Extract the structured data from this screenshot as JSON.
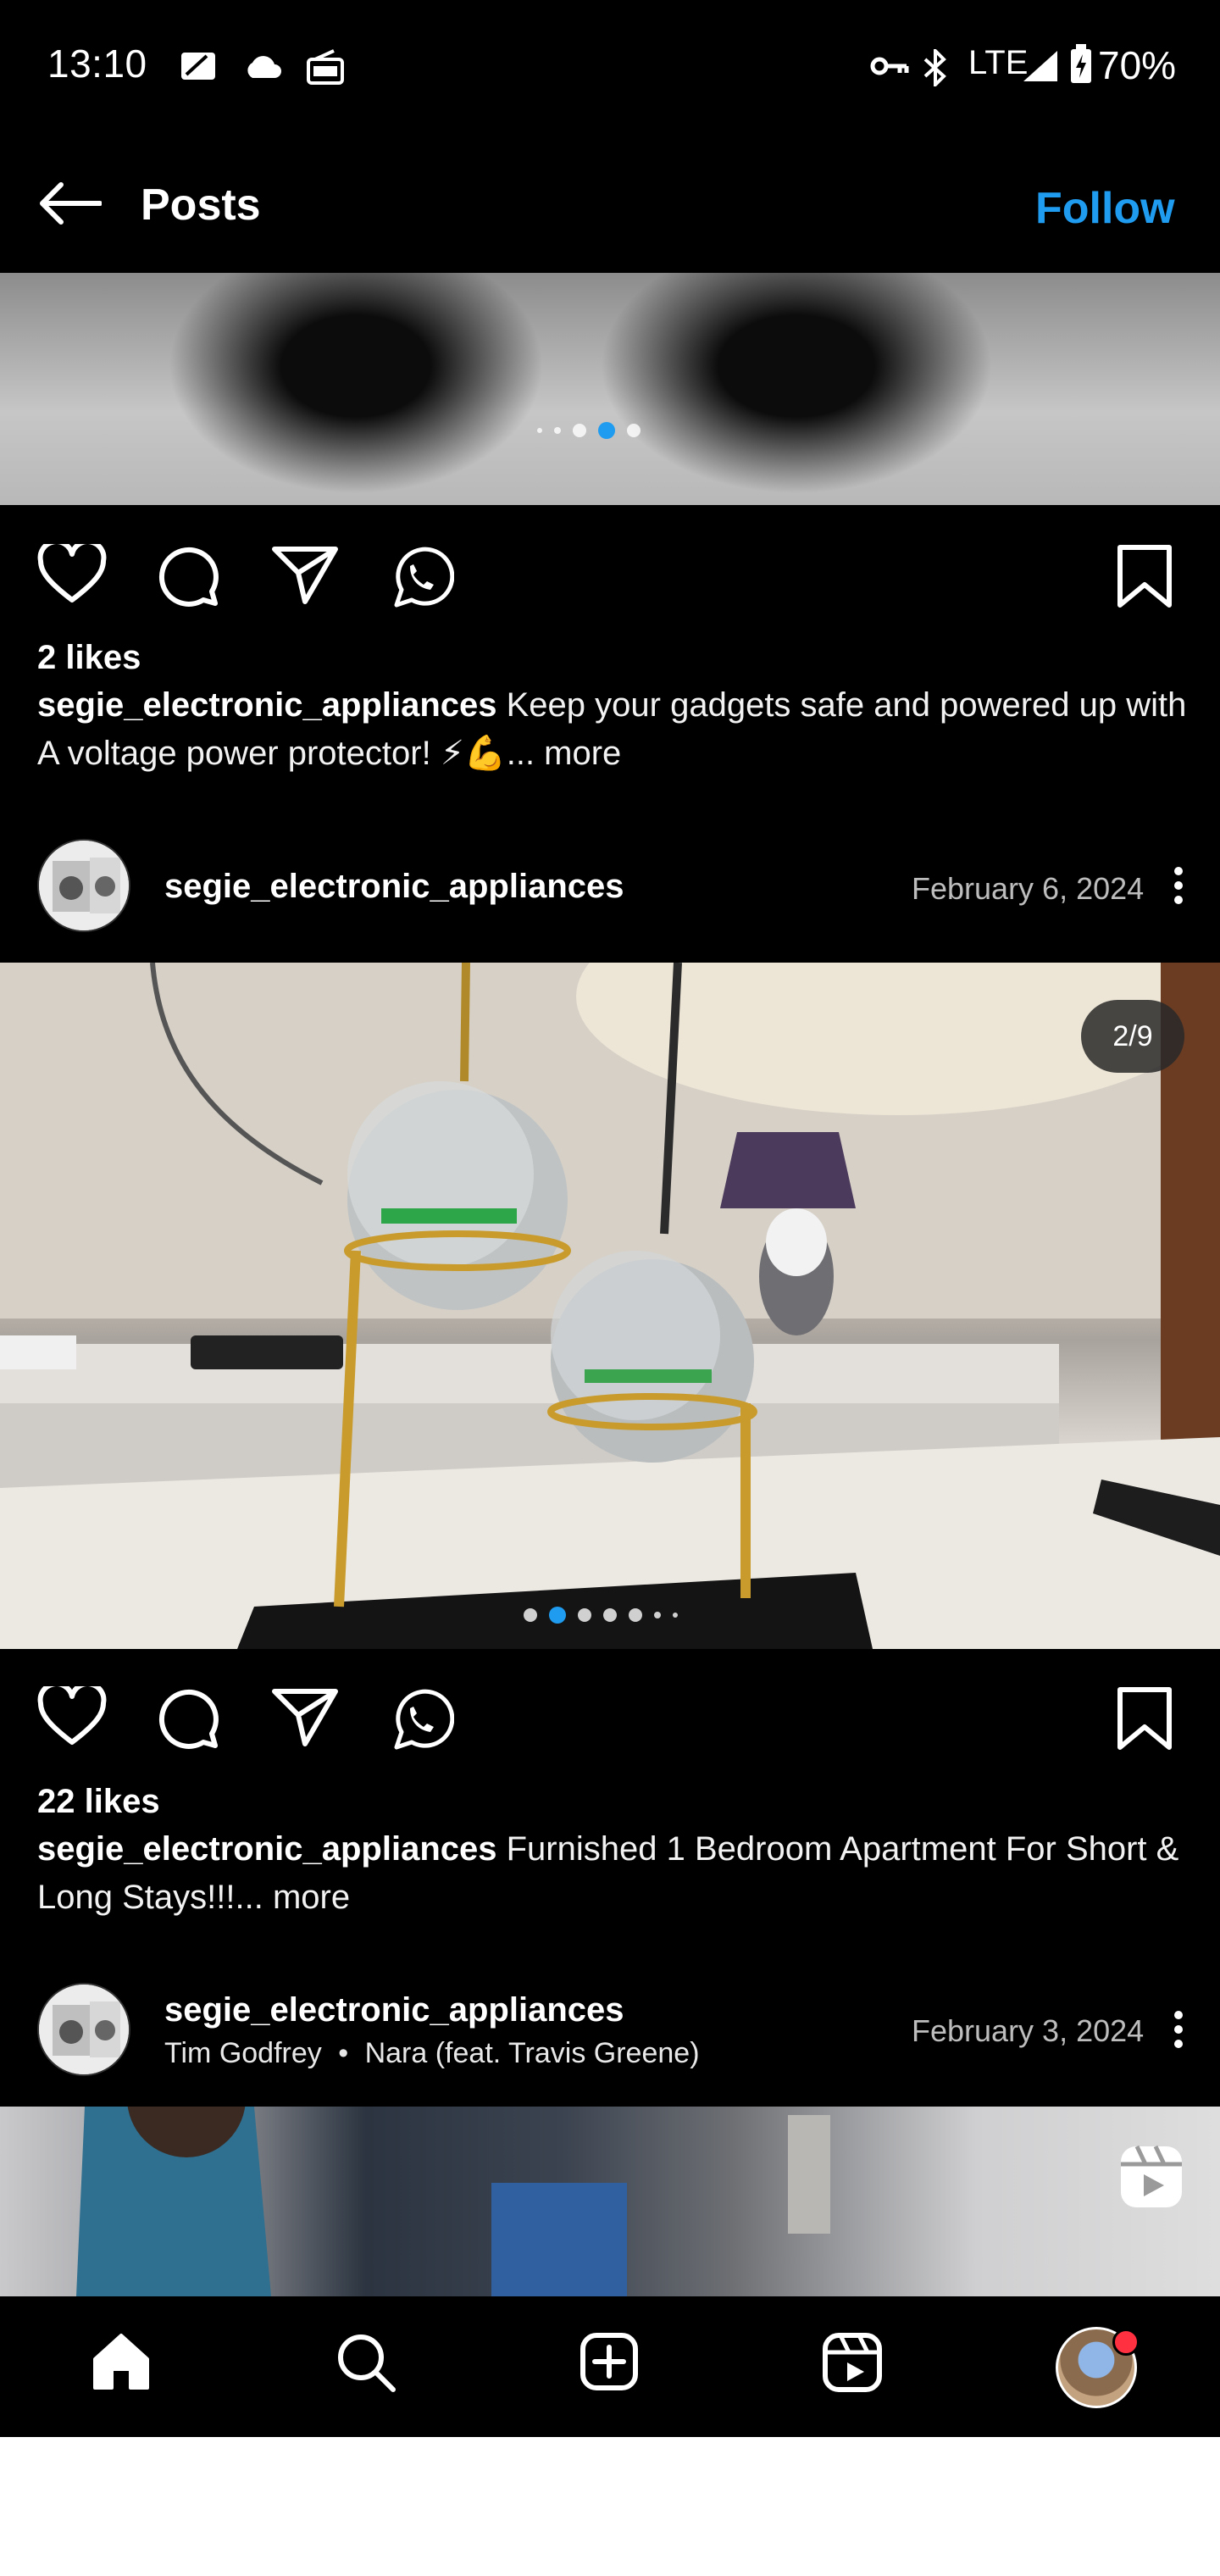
{
  "status_bar": {
    "time": "13:10",
    "network": "LTE",
    "battery": "70%",
    "icons": [
      "notes-icon",
      "cloud-icon",
      "radio-icon",
      "vpn-key-icon",
      "bluetooth-icon",
      "signal-icon",
      "battery-charging-icon"
    ]
  },
  "top_bar": {
    "title": "Posts",
    "follow_label": "Follow"
  },
  "posts": [
    {
      "carousel": {
        "count": 5,
        "active_index": 3
      },
      "likes": "2 likes",
      "username": "segie_electronic_appliances",
      "caption": "Keep your gadgets safe and powered up with A voltage power protector! ⚡💪",
      "more": "... more"
    },
    {
      "username": "segie_electronic_appliances",
      "date": "February 6, 2024",
      "counter": "2/9",
      "carousel": {
        "count": 7,
        "active_index": 1
      },
      "likes": "22 likes",
      "caption": "Furnished 1 Bedroom Apartment For Short & Long Stays!!!",
      "more": "... more"
    },
    {
      "username": "segie_electronic_appliances",
      "date": "February 3, 2024",
      "music_artist": "Tim Godfrey",
      "music_separator": "•",
      "music_track": "Nara (feat. Travis Greene)"
    }
  ],
  "nav": {
    "items": [
      "home-icon",
      "search-icon",
      "create-icon",
      "reels-icon",
      "profile-avatar"
    ]
  },
  "colors": {
    "accent": "#1f9cf0",
    "notification": "#ff3040",
    "background": "#000000"
  }
}
